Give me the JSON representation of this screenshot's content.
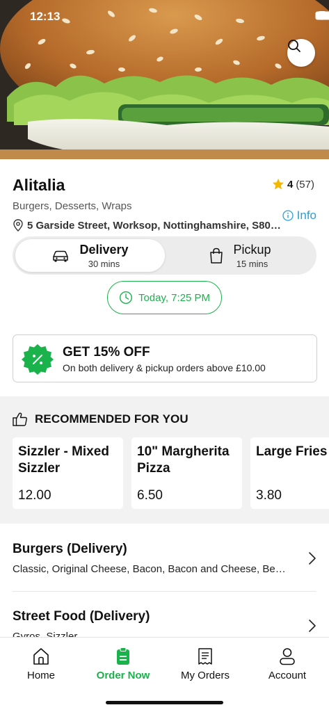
{
  "status_bar": {
    "time": "12:13"
  },
  "restaurant": {
    "name": "Alitalia",
    "rating": "4",
    "rating_count": "(57)",
    "cuisines": "Burgers, Desserts, Wraps",
    "address": "5 Garside Street, Worksop, Nottinghamshire, S80…",
    "info_label": "Info"
  },
  "order_mode": {
    "delivery": {
      "label": "Delivery",
      "time": "30 mins",
      "selected": true
    },
    "pickup": {
      "label": "Pickup",
      "time": "15 mins",
      "selected": false
    }
  },
  "schedule": {
    "label": "Today, 7:25 PM"
  },
  "offer": {
    "title": "GET 15% OFF",
    "description": "On both delivery & pickup orders above £10.00"
  },
  "recommended": {
    "title": "RECOMMENDED FOR YOU",
    "items": [
      {
        "name": "Sizzler - Mixed Sizzler",
        "price": "12.00"
      },
      {
        "name": "10\" Margherita Pizza",
        "price": "6.50"
      },
      {
        "name": "Large Fries",
        "price": "3.80"
      }
    ]
  },
  "categories": [
    {
      "title": "Burgers (Delivery)",
      "description": "Classic, Original Cheese, Bacon, Bacon and Cheese, Be…"
    },
    {
      "title": "Street Food (Delivery)",
      "description": "Gyros, Sizzler"
    }
  ],
  "bottom_nav": [
    {
      "label": "Home",
      "icon": "home-icon",
      "active": false
    },
    {
      "label": "Order Now",
      "icon": "order-icon",
      "active": true
    },
    {
      "label": "My Orders",
      "icon": "receipt-icon",
      "active": false
    },
    {
      "label": "Account",
      "icon": "person-icon",
      "active": false
    }
  ],
  "colors": {
    "accent_green": "#19b24b",
    "info_blue": "#2a9fd6",
    "star": "#f5b800"
  }
}
